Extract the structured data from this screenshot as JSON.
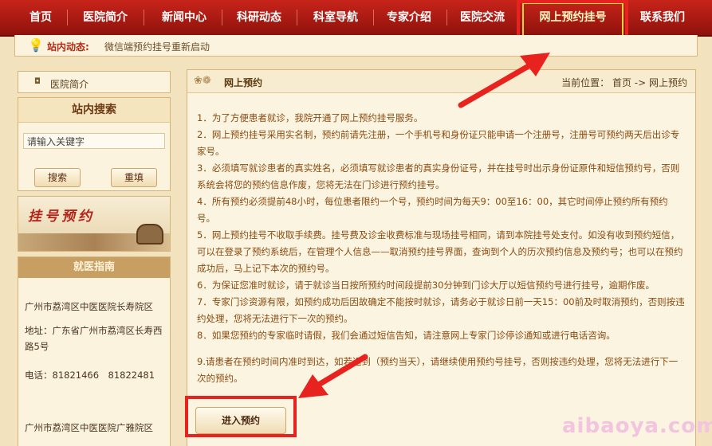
{
  "nav": {
    "items": [
      "首页",
      "医院简介",
      "新闻中心",
      "科研动态",
      "科室导航",
      "专家介绍",
      "医院交流",
      "网上预约挂号",
      "联系我们"
    ]
  },
  "news": {
    "label": "站内动态:",
    "text": "微信端预约挂号重新启动"
  },
  "sidebar": {
    "intro": "医院简介",
    "search": {
      "title": "站内搜索",
      "placeholder": "请输入关键字",
      "search_label": "搜索",
      "reset_label": "重填"
    },
    "banner": "挂号预约",
    "guide": {
      "title": "就医指南",
      "lines": [
        "广州市荔湾区中医医院长寿院区",
        "地址：广东省广州市荔湾区长寿西路5号",
        "电话：81821466　81822481",
        "广州市荔湾区中医医院广雅院区"
      ]
    }
  },
  "main": {
    "title": "网上预约",
    "crumb": "当前位置：  首页 -> 网上预约",
    "rules": [
      "1．为了方便患者就诊，我院开通了网上预约挂号服务。",
      "2．网上预约挂号采用实名制，预约前请先注册，一个手机号和身份证只能申请一个注册号，注册号可预约两天后出诊专家号。",
      "3．必须填写就诊患者的真实姓名，必须填写就诊患者的真实身份证号，并在挂号时出示身份证原件和短信预约号，否则系统会将您的预约信息作废，您将无法在门诊进行预约挂号。",
      "4．所有预约必须提前48小时，每位患者限约一个号，预约时间为每天9：00至16：00，其它时间停止预约所有预约号。",
      "5．网上预约挂号不收取手续费。挂号费及诊金收费标准与现场挂号相同，请到本院挂号处支付。如没有收到预约短信，可以在登录了预约系统后，在管理个人信息——取消预约挂号界面，查询到个人的历次预约信息及预约号；也可以在预约成功后，马上记下本次的预约号。",
      "6．为保证您准时就诊，请于就诊当日按所预约时间段提前30分钟到门诊大厅以短信预约号进行挂号，逾期作废。",
      "7．专家门诊资源有限，如预约成功后因故确定不能按时就诊，请务必于就诊日前一天15：00前及时取消预约，否则按违约处理，您将无法进行下一次的预约。",
      "8．如果您预约的专家临时请假，我们会通过短信告知，请注意网上专家门诊停诊通知或进行电话咨询。"
    ],
    "note": "9.请患者在预约时间内准时到达，如若迟到（预约当天），请继续使用预约号挂号，否则按违约处理，您将无法进行下一次的预约。",
    "enter_label": "进入预约"
  },
  "watermark": "aibaoya.com",
  "colors": {
    "nav_red": "#a81a12",
    "highlight": "#e8231f",
    "text_brown": "#8a4a10"
  }
}
